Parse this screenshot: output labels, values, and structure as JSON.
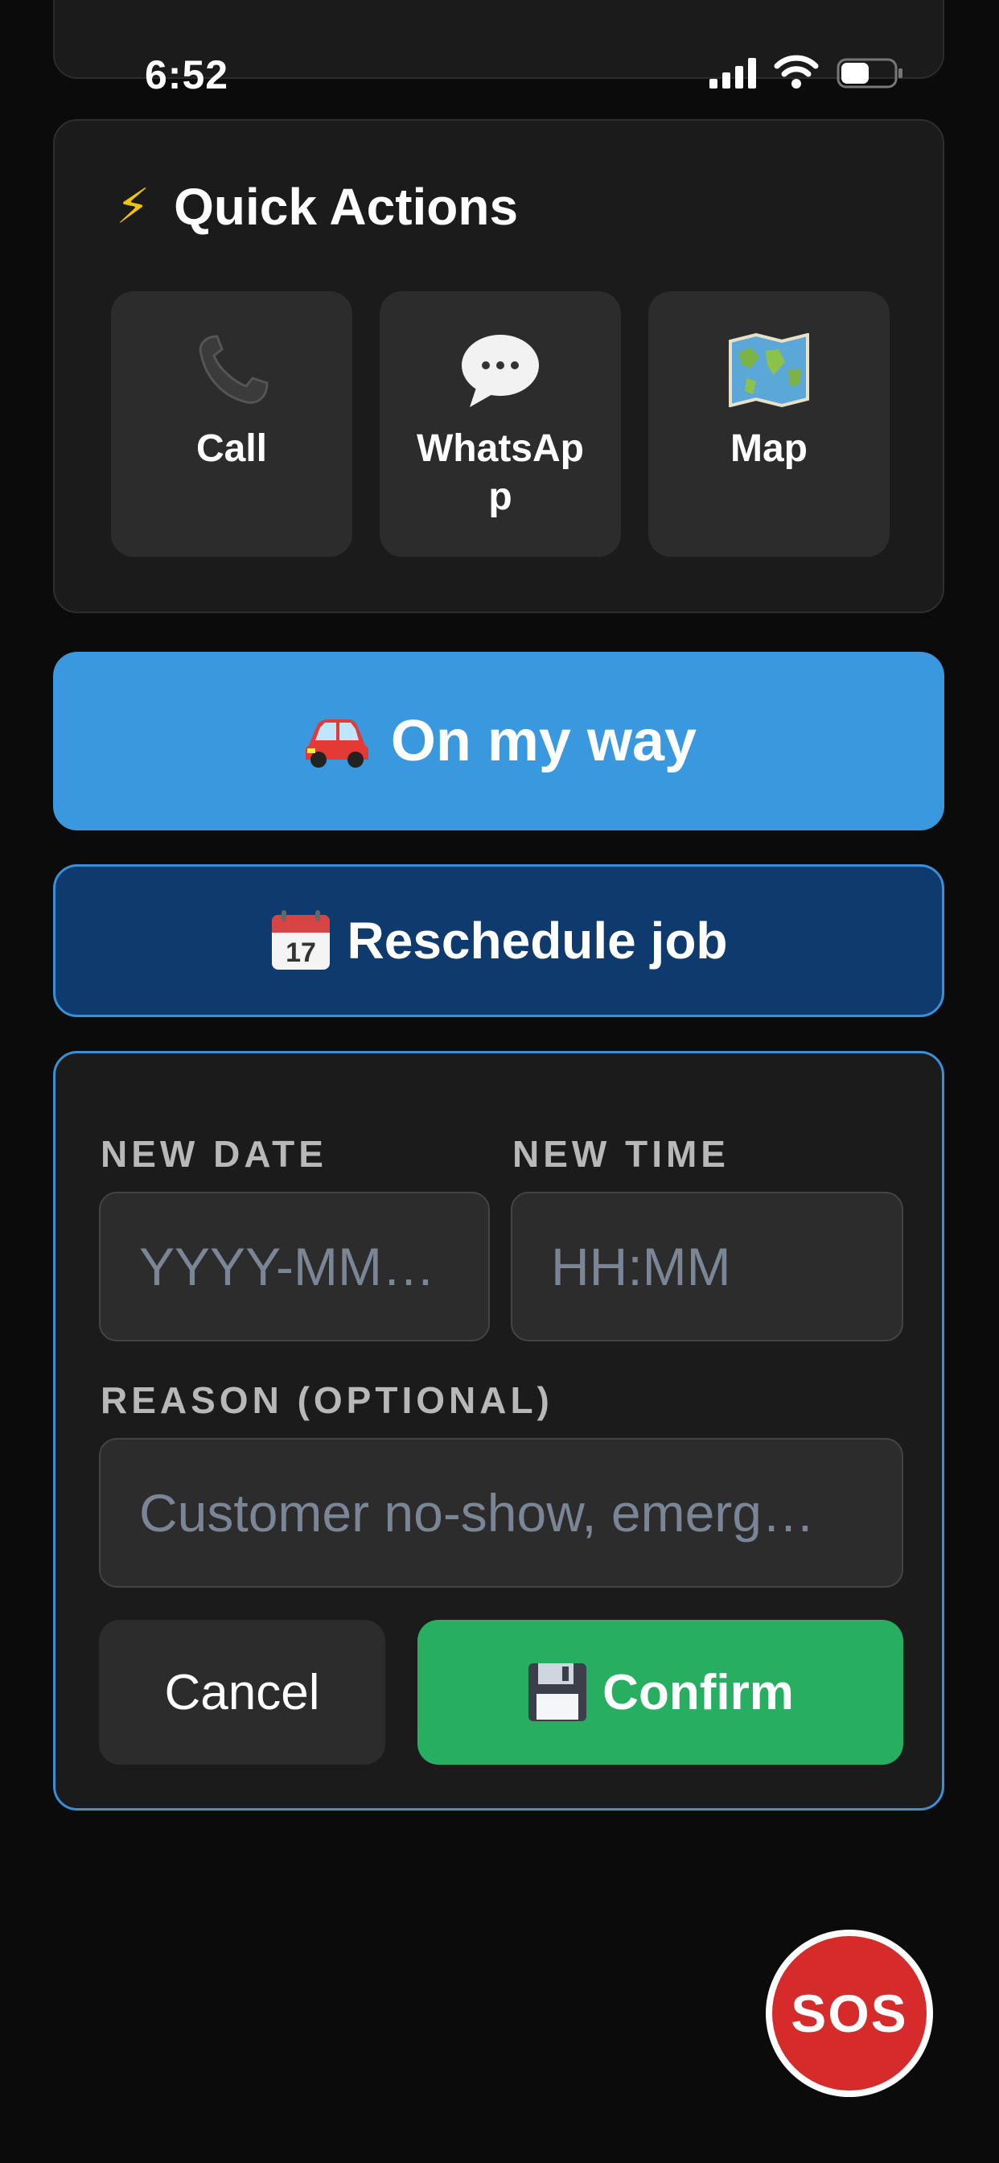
{
  "status_bar": {
    "time": "6:52"
  },
  "quick_actions": {
    "title": "Quick Actions",
    "items": [
      {
        "label": "Call",
        "icon": "phone-icon"
      },
      {
        "label": "WhatsApp",
        "icon": "speech-bubble-icon"
      },
      {
        "label": "Map",
        "icon": "world-map-icon"
      }
    ]
  },
  "on_my_way": {
    "label": "On my way",
    "icon": "car-icon"
  },
  "reschedule": {
    "label": "Reschedule job",
    "icon": "calendar-icon"
  },
  "form": {
    "date_label": "NEW DATE",
    "date_placeholder": "YYYY-MM…",
    "time_label": "NEW TIME",
    "time_placeholder": "HH:MM",
    "reason_label": "REASON (OPTIONAL)",
    "reason_placeholder": "Customer no-show, emerg…",
    "cancel_label": "Cancel",
    "confirm_label": "Confirm"
  },
  "sos": {
    "label": "SOS"
  },
  "colors": {
    "primary_blue": "#3a99de",
    "reschedule_navy": "#0e3a6e",
    "confirm_green": "#27ae60",
    "sos_red": "#d62b2b"
  }
}
